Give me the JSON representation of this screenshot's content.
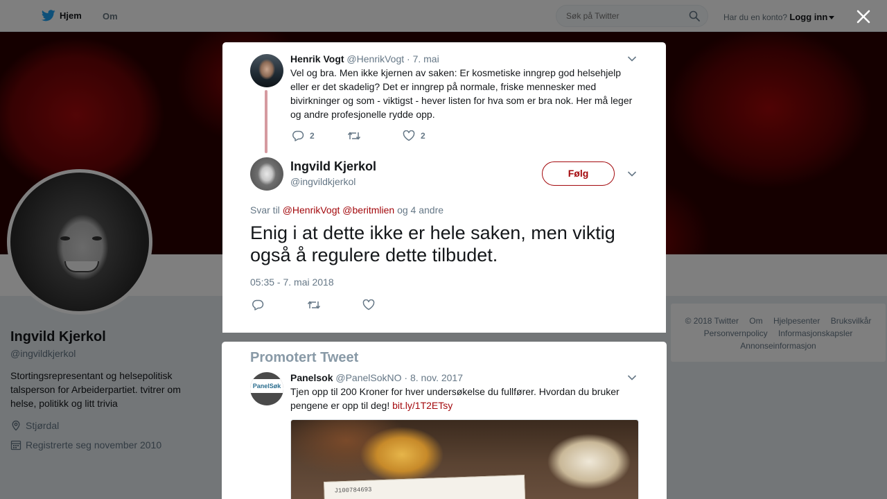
{
  "topnav": {
    "home_label": "Hjem",
    "about_label": "Om",
    "search_placeholder": "Søk på Twitter",
    "account_prompt": "Har du en konto?",
    "login_label": "Logg inn"
  },
  "profile": {
    "name": "Ingvild Kjerkol",
    "handle": "@ingvildkjerkol",
    "bio": "Stortingsrepresentant og helsepolitisk talsperson for Arbeiderpartiet. tvitrer om helse, politikk og litt trivia",
    "location": "Stjørdal",
    "joined": "Registrerte seg november 2010"
  },
  "footer": {
    "links": [
      "© 2018 Twitter",
      "Om",
      "Hjelpesenter",
      "Bruksvilkår",
      "Personvernpolicy",
      "Informasjonskapsler",
      "Annonseinformasjon"
    ]
  },
  "parent_tweet": {
    "name": "Henrik Vogt",
    "handle": "@HenrikVogt",
    "date": "7. mai",
    "text": "Vel og bra. Men ikke kjernen av saken: Er kosmetiske inngrep god helsehjelp eller er det skadelig? Det er inngrep på normale, friske mennesker med bivirkninger og som - viktigst - hever listen for hva som er bra nok. Her må leger og andre profesjonelle rydde opp.",
    "reply_count": "2",
    "like_count": "2"
  },
  "main_tweet": {
    "name": "Ingvild Kjerkol",
    "handle": "@ingvildkjerkol",
    "follow_label": "Følg",
    "reply_prefix": "Svar til",
    "reply_user1": "@HenrikVogt",
    "reply_user2": "@beritmlien",
    "reply_suffix": "og 4 andre",
    "text": "Enig i at dette ikke er hele saken, men viktig også å regulere dette tilbudet.",
    "timestamp": "05:35 - 7. mai 2018"
  },
  "promo": {
    "header": "Promotert Tweet",
    "name": "Panelsok",
    "handle": "@PanelSokNO",
    "date": "8. nov. 2017",
    "text": "Tjen opp til 200 Kroner for hver undersøkelse du fullfører. Hvordan du bruker pengene er opp til deg!",
    "link": "bit.ly/1T2ETsy",
    "avatar_text": "PanelSøk",
    "image_serial": "J100784693"
  },
  "colors": {
    "accent": "#a3080c",
    "muted": "#657786",
    "thread_line": "#d59aa0"
  }
}
